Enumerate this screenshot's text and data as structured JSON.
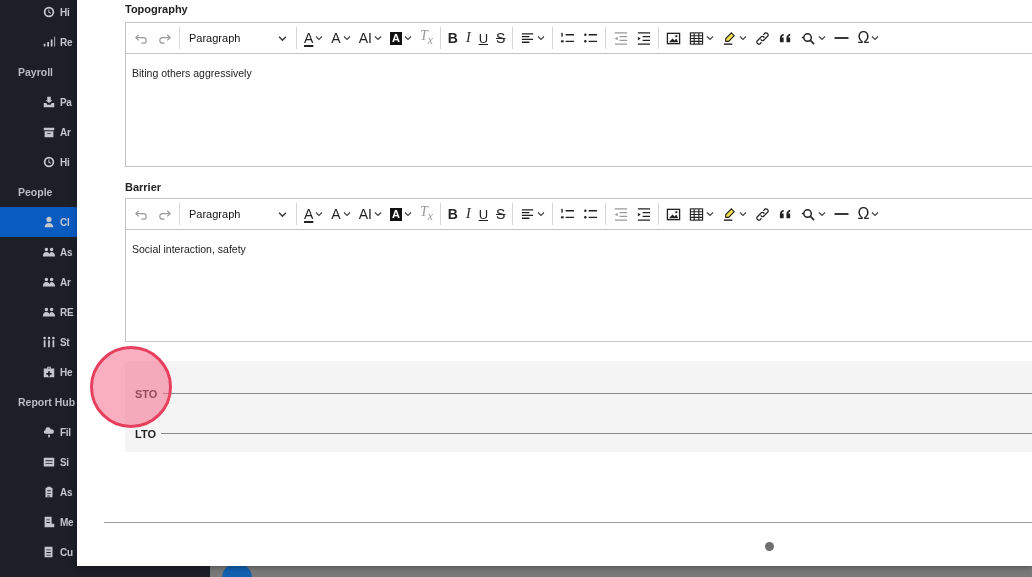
{
  "sidebar": {
    "items": [
      {
        "kind": "item",
        "label": "Hi",
        "selected": false
      },
      {
        "kind": "item",
        "label": "Re",
        "selected": false
      },
      {
        "kind": "header",
        "label": "Payroll"
      },
      {
        "kind": "item",
        "label": "Pa",
        "selected": false
      },
      {
        "kind": "item",
        "label": "Ar",
        "selected": false
      },
      {
        "kind": "item",
        "label": "Hi",
        "selected": false
      },
      {
        "kind": "header",
        "label": "People"
      },
      {
        "kind": "item",
        "label": "Cl",
        "selected": true
      },
      {
        "kind": "item",
        "label": "As",
        "selected": false
      },
      {
        "kind": "item",
        "label": "Ar",
        "selected": false
      },
      {
        "kind": "item",
        "label": "RE",
        "selected": false
      },
      {
        "kind": "item",
        "label": "St",
        "selected": false
      },
      {
        "kind": "item",
        "label": "He",
        "selected": false
      },
      {
        "kind": "header",
        "label": "Report Hub"
      },
      {
        "kind": "item",
        "label": "Fil",
        "selected": false
      },
      {
        "kind": "item",
        "label": "Si",
        "selected": false
      },
      {
        "kind": "item",
        "label": "As",
        "selected": false
      },
      {
        "kind": "item",
        "label": "Me",
        "selected": false
      },
      {
        "kind": "item",
        "label": "Cu",
        "selected": false
      }
    ]
  },
  "editors": [
    {
      "label": "Topography",
      "format": "Paragraph",
      "content": "Biting others aggressively",
      "tool_groups": [
        [
          {
            "kind": "button",
            "disabled": true
          },
          {
            "kind": "button",
            "disabled": true
          }
        ],
        [
          {
            "kind": "dropdown",
            "glyph": "A",
            "disabled": false
          },
          {
            "kind": "dropdown",
            "glyph": "A",
            "disabled": false
          },
          {
            "kind": "dropdown",
            "glyph": "AI",
            "disabled": false
          },
          {
            "kind": "dropdown",
            "glyph": "A",
            "disabled": false
          },
          {
            "kind": "button",
            "glyph": "T$_{x}$",
            "disabled": true
          }
        ],
        [
          {
            "kind": "button",
            "glyph": "B",
            "disabled": false
          },
          {
            "kind": "button",
            "glyph": "I",
            "disabled": false
          },
          {
            "kind": "button",
            "glyph": "U",
            "disabled": false
          },
          {
            "kind": "button",
            "glyph": "S",
            "disabled": false
          }
        ],
        [
          {
            "kind": "dropdown",
            "disabled": false
          }
        ],
        [
          {
            "kind": "button",
            "disabled": false
          },
          {
            "kind": "button",
            "disabled": false
          }
        ],
        [
          {
            "kind": "button",
            "disabled": true
          },
          {
            "kind": "button",
            "disabled": false
          }
        ],
        [
          {
            "kind": "button",
            "disabled": false
          },
          {
            "kind": "dropdown",
            "disabled": false
          },
          {
            "kind": "dropdown",
            "disabled": false
          },
          {
            "kind": "button",
            "disabled": false
          },
          {
            "kind": "button",
            "disabled": false
          },
          {
            "kind": "dropdown",
            "disabled": false
          },
          {
            "kind": "button",
            "disabled": false
          },
          {
            "kind": "dropdown",
            "glyph": "Ω",
            "disabled": false
          }
        ]
      ]
    },
    {
      "label": "Barrier",
      "format": "Paragraph",
      "content": "Social interaction, safety",
      "tool_groups": [
        [
          {
            "kind": "button",
            "disabled": true
          },
          {
            "kind": "button",
            "disabled": true
          }
        ],
        [
          {
            "kind": "dropdown",
            "glyph": "A",
            "disabled": false
          },
          {
            "kind": "dropdown",
            "glyph": "A",
            "disabled": false
          },
          {
            "kind": "dropdown",
            "glyph": "AI",
            "disabled": false
          },
          {
            "kind": "dropdown",
            "glyph": "A",
            "disabled": false
          },
          {
            "kind": "button",
            "glyph": "T$_{x}$",
            "disabled": true
          }
        ],
        [
          {
            "kind": "button",
            "glyph": "B",
            "disabled": false
          },
          {
            "kind": "button",
            "glyph": "I",
            "disabled": false
          },
          {
            "kind": "button",
            "glyph": "U",
            "disabled": false
          },
          {
            "kind": "button",
            "glyph": "S",
            "disabled": false
          }
        ],
        [
          {
            "kind": "dropdown",
            "disabled": false
          }
        ],
        [
          {
            "kind": "button",
            "disabled": false
          },
          {
            "kind": "button",
            "disabled": false
          }
        ],
        [
          {
            "kind": "button",
            "disabled": true
          },
          {
            "kind": "button",
            "disabled": false
          }
        ],
        [
          {
            "kind": "button",
            "disabled": false
          },
          {
            "kind": "dropdown",
            "disabled": false
          },
          {
            "kind": "dropdown",
            "disabled": false
          },
          {
            "kind": "button",
            "disabled": false
          },
          {
            "kind": "button",
            "disabled": false
          },
          {
            "kind": "dropdown",
            "disabled": false
          },
          {
            "kind": "button",
            "disabled": false
          },
          {
            "kind": "dropdown",
            "glyph": "Ω",
            "disabled": false
          }
        ]
      ]
    }
  ],
  "goals": [
    {
      "label": "STO"
    },
    {
      "label": "LTO"
    }
  ]
}
